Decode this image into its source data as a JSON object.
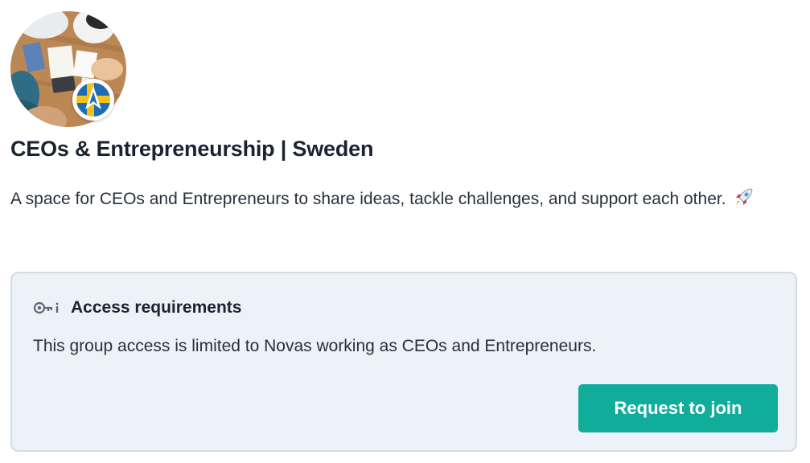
{
  "group": {
    "avatar_icon": "group-photo-meeting-table",
    "badge_icon": "nova-logo-swedish-flag",
    "title": "CEOs & Entrepreneurship | Sweden",
    "description": "A space for CEOs and Entrepreneurs to share ideas, tackle challenges, and support each other.",
    "description_emoji": "rocket-icon"
  },
  "access": {
    "icon": "key-icon",
    "title": "Access requirements",
    "body": "This group access is limited to Novas working as CEOs and Entrepreneurs.",
    "button_label": "Request to join"
  },
  "colors": {
    "card_background": "#edf1f8",
    "card_border": "#d5dbe4",
    "button": "#10ad9a",
    "text": "#1b2330"
  }
}
